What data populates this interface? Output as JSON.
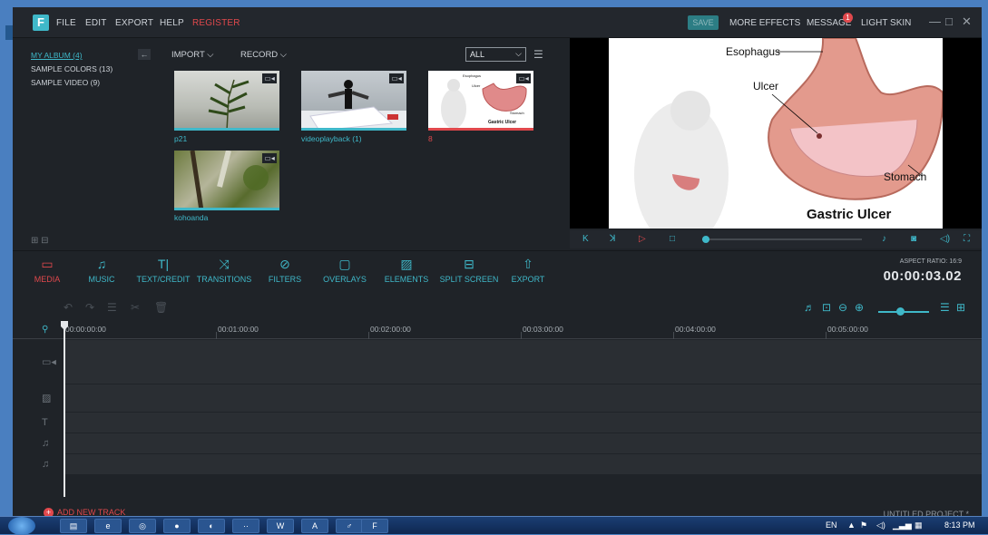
{
  "app": {
    "logo": "F",
    "menu": [
      "FILE",
      "EDIT",
      "EXPORT",
      "HELP",
      "REGISTER"
    ],
    "save_label": "SAVE",
    "more_effects": "MORE EFFECTS",
    "message": "MESSAGE",
    "message_badge": "1",
    "light_skin": "LIGHT SKIN",
    "win_min": "—",
    "win_max": "□",
    "win_close": "✕"
  },
  "albums": [
    {
      "label": "MY ALBUM (4)",
      "selected": true
    },
    {
      "label": "SAMPLE COLORS (13)",
      "selected": false
    },
    {
      "label": "SAMPLE VIDEO (9)",
      "selected": false
    }
  ],
  "library_toolbar": {
    "import": "IMPORT",
    "record": "RECORD",
    "filter_value": "ALL"
  },
  "media": [
    {
      "name": "p21",
      "highlight": "#3fb8c9"
    },
    {
      "name": "videoplayback (1)",
      "highlight": "#3fb8c9"
    },
    {
      "name": "8",
      "highlight": "#e0484c"
    },
    {
      "name": "kohoanda",
      "highlight": "#3fb8c9"
    }
  ],
  "preview": {
    "labels": {
      "esophagus": "Esophagus",
      "ulcer": "Ulcer",
      "stomach": "Stomach",
      "title": "Gastric Ulcer"
    },
    "thumb_labels": {
      "esophagus": "Esophagus",
      "ulcer": "Ulcer",
      "stomach": "Stomach",
      "title": "Gastric Ulcer"
    }
  },
  "tabs": [
    {
      "icon": "▭",
      "label": "MEDIA",
      "active": true
    },
    {
      "icon": "♫",
      "label": "MUSIC",
      "active": false
    },
    {
      "icon": "T|",
      "label": "TEXT/CREDIT",
      "active": false
    },
    {
      "icon": "⤨",
      "label": "TRANSITIONS",
      "active": false
    },
    {
      "icon": "⊘",
      "label": "FILTERS",
      "active": false
    },
    {
      "icon": "▢",
      "label": "OVERLAYS",
      "active": false
    },
    {
      "icon": "▨",
      "label": "ELEMENTS",
      "active": false
    },
    {
      "icon": "⊟",
      "label": "SPLIT SCREEN",
      "active": false
    },
    {
      "icon": "⇧",
      "label": "EXPORT",
      "active": false
    }
  ],
  "aspect_ratio": "ASPECT RATIO: 16:9",
  "timecode": "00:00:03.02",
  "ruler": [
    "00:00:00:00",
    "00:01:00:00",
    "00:02:00:00",
    "00:03:00:00",
    "00:04:00:00",
    "00:05:00:00"
  ],
  "add_track": "ADD NEW TRACK",
  "project": "UNTITLED PROJECT *",
  "taskbar": {
    "apps": [
      "▤",
      "e",
      "◎",
      "●",
      "◐",
      "··",
      "W",
      "A",
      "♂",
      "F"
    ],
    "lang": "EN",
    "time": "8:13 PM"
  },
  "colors": {
    "accent": "#3fb8c9",
    "red": "#e0484c",
    "bg": "#1f2328"
  }
}
